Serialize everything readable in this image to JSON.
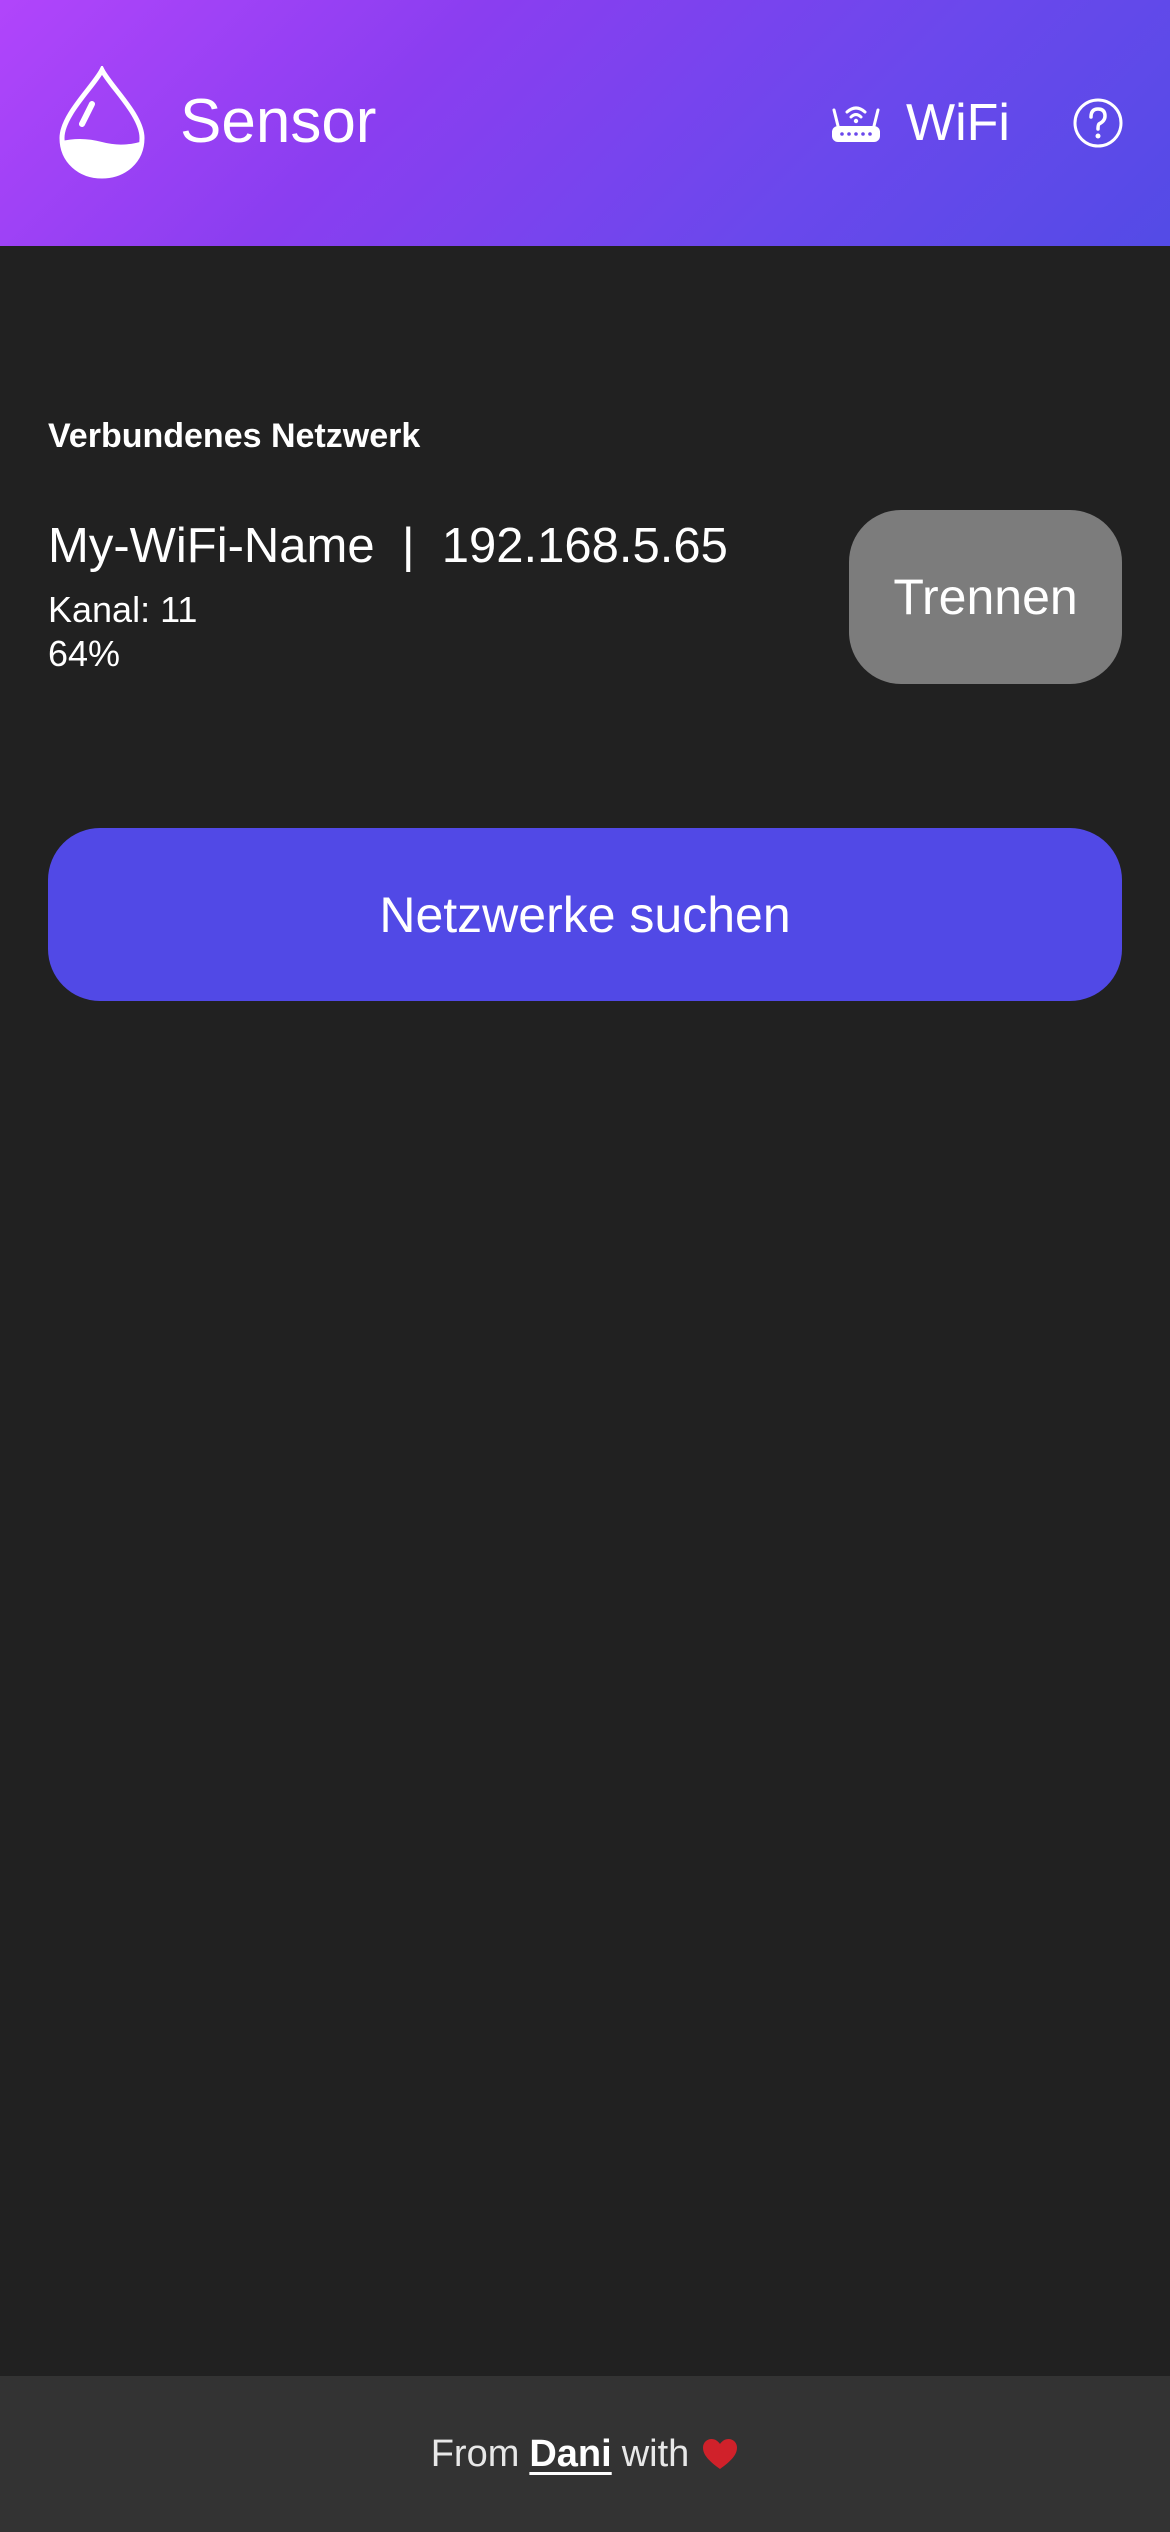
{
  "header": {
    "app_title": "Sensor",
    "logo_icon": "water-drop-icon",
    "nav_wifi": {
      "icon": "router-icon",
      "label": "WiFi"
    },
    "help_icon": "help-circle-icon"
  },
  "connected_network": {
    "section_title": "Verbundenes Netzwerk",
    "summary": "My-WiFi-Name  |  192.168.5.65",
    "channel": "Kanal: 11",
    "signal": "64%",
    "disconnect_label": "Trennen"
  },
  "scan_button_label": "Netzwerke suchen",
  "footer": {
    "prefix": "From",
    "author": "Dani",
    "suffix": "with",
    "heart_icon": "heart-icon"
  },
  "colors": {
    "background": "#212121",
    "header_gradient_start": "#b145fb",
    "header_gradient_end": "#534be6",
    "primary_button": "#5149e6",
    "secondary_button": "#7c7c7c",
    "footer_background": "#333333",
    "heart": "#d0212a"
  }
}
